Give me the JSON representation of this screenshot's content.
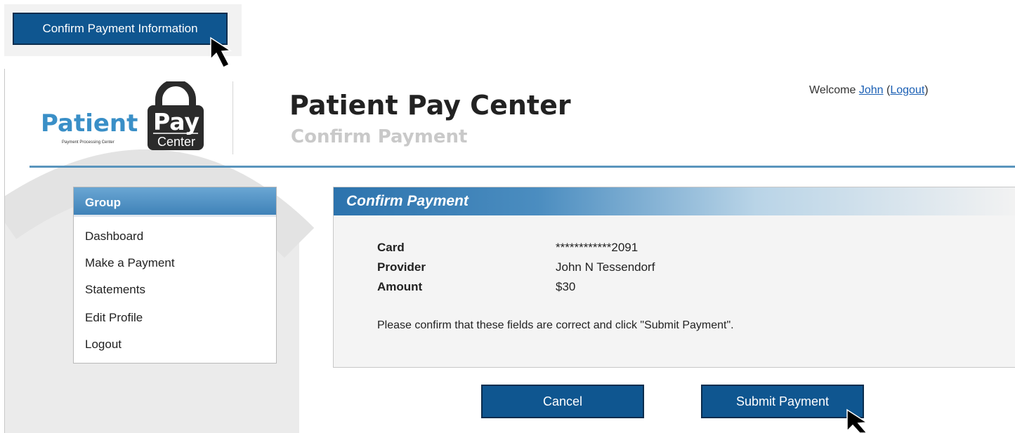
{
  "top_button": {
    "label": "Confirm Payment Information"
  },
  "logo": {
    "word": "Patient",
    "tagline": "Payment Processing Center",
    "badge_top": "Pay",
    "badge_bottom": "Center"
  },
  "header": {
    "title": "Patient Pay Center",
    "subtitle": "Confirm Payment",
    "welcome_prefix": "Welcome ",
    "user_name": "John",
    "logout_link": "Logout"
  },
  "sidebar": {
    "heading": "Group",
    "items": [
      {
        "label": "Dashboard"
      },
      {
        "label": "Make a Payment"
      },
      {
        "label": "Statements"
      },
      {
        "label": "Edit Profile"
      },
      {
        "label": "Logout"
      }
    ]
  },
  "panel": {
    "heading": "Confirm Payment",
    "fields": [
      {
        "label": "Card",
        "value": "************2091"
      },
      {
        "label": "Provider",
        "value": "John N Tessendorf"
      },
      {
        "label": "Amount",
        "value": "$30"
      }
    ],
    "note": "Please confirm that these fields are correct and click \"Submit Payment\"."
  },
  "actions": {
    "cancel_label": "Cancel",
    "submit_label": "Submit Payment"
  },
  "colors": {
    "button_bg": "#0f5690",
    "brand_blue": "#3a8fc7",
    "link": "#1a5fb4"
  },
  "icons": [
    "cursor-arrow-icon",
    "padlock-icon"
  ]
}
